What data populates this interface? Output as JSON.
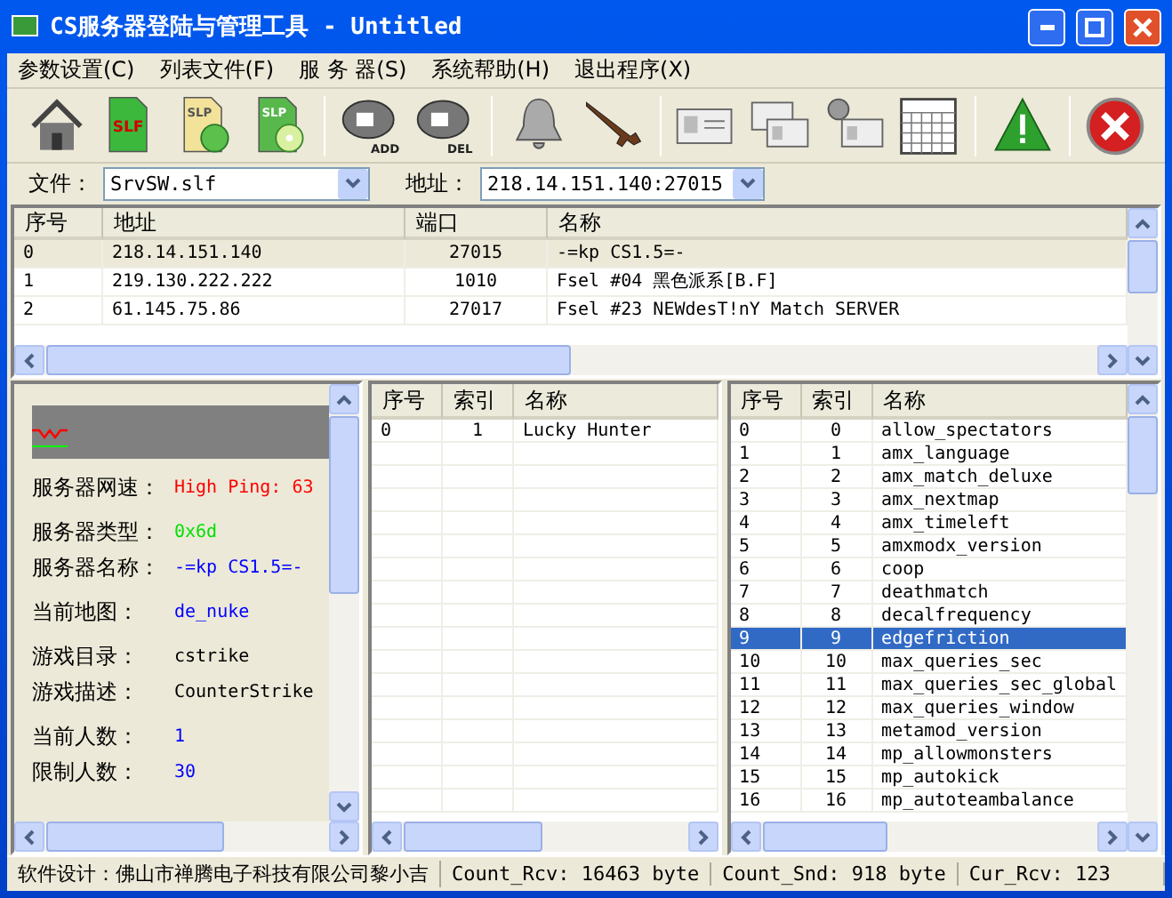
{
  "window": {
    "title": "CS服务器登陆与管理工具 - Untitled"
  },
  "menu": [
    {
      "label": "参数设置(C)"
    },
    {
      "label": "列表文件(F)"
    },
    {
      "label": "服 务 器(S)"
    },
    {
      "label": "系统帮助(H)"
    },
    {
      "label": "退出程序(X)"
    }
  ],
  "toolbar_labels": [
    "SLF",
    "SLP",
    "SLP",
    "ADD",
    "DEL"
  ],
  "address_bar": {
    "file_label": "文件：",
    "file_value": "SrvSW.slf",
    "address_label": "地址：",
    "address_value": "218.14.151.140:27015"
  },
  "servers": {
    "columns": [
      "序号",
      "地址",
      "端口",
      "名称"
    ],
    "rows": [
      {
        "cells": [
          "0",
          "218.14.151.140",
          "27015",
          "-=kp  CS1.5=-"
        ],
        "selected": true
      },
      {
        "cells": [
          "1",
          "219.130.222.222",
          "1010",
          "Fsel #04 黑色派系[B.F]"
        ],
        "selected": false
      },
      {
        "cells": [
          "2",
          "61.145.75.86",
          "27017",
          "Fsel #23 NEWdesT!nY Match SERVER"
        ],
        "selected": false
      }
    ]
  },
  "server_info": {
    "groups": [
      {
        "rows": [
          {
            "label": "服务器网速：",
            "value": "High Ping: 63",
            "color": "#ff0000"
          }
        ]
      },
      {
        "rows": [
          {
            "label": "服务器类型：",
            "value": "0x6d",
            "color": "#00e000"
          },
          {
            "label": "服务器名称：",
            "value": "-=kp  CS1.5=-",
            "color": "#0000ff"
          }
        ]
      },
      {
        "rows": [
          {
            "label": "当前地图：",
            "value": "de_nuke",
            "color": "#0000ff"
          }
        ]
      },
      {
        "rows": [
          {
            "label": "游戏目录：",
            "value": "cstrike",
            "color": "#000000"
          },
          {
            "label": "游戏描述：",
            "value": "CounterStrike",
            "color": "#000000"
          }
        ]
      },
      {
        "rows": [
          {
            "label": "当前人数：",
            "value": "1",
            "color": "#0000ff"
          },
          {
            "label": "限制人数：",
            "value": "30",
            "color": "#0000ff"
          }
        ]
      }
    ]
  },
  "players": {
    "columns": [
      "序号",
      "索引",
      "名称"
    ],
    "rows": [
      {
        "cells": [
          "0",
          "1",
          "Lucky Hunter"
        ],
        "selected": false
      }
    ]
  },
  "cvars": {
    "columns": [
      "序号",
      "索引",
      "名称"
    ],
    "rows": [
      {
        "cells": [
          "0",
          "0",
          "allow_spectators"
        ],
        "selected": false
      },
      {
        "cells": [
          "1",
          "1",
          "amx_language"
        ],
        "selected": false
      },
      {
        "cells": [
          "2",
          "2",
          "amx_match_deluxe"
        ],
        "selected": false
      },
      {
        "cells": [
          "3",
          "3",
          "amx_nextmap"
        ],
        "selected": false
      },
      {
        "cells": [
          "4",
          "4",
          "amx_timeleft"
        ],
        "selected": false
      },
      {
        "cells": [
          "5",
          "5",
          "amxmodx_version"
        ],
        "selected": false
      },
      {
        "cells": [
          "6",
          "6",
          "coop"
        ],
        "selected": false
      },
      {
        "cells": [
          "7",
          "7",
          "deathmatch"
        ],
        "selected": false
      },
      {
        "cells": [
          "8",
          "8",
          "decalfrequency"
        ],
        "selected": false
      },
      {
        "cells": [
          "9",
          "9",
          "edgefriction"
        ],
        "selected": true
      },
      {
        "cells": [
          "10",
          "10",
          "max_queries_sec"
        ],
        "selected": false
      },
      {
        "cells": [
          "11",
          "11",
          "max_queries_sec_global"
        ],
        "selected": false
      },
      {
        "cells": [
          "12",
          "12",
          "max_queries_window"
        ],
        "selected": false
      },
      {
        "cells": [
          "13",
          "13",
          "metamod_version"
        ],
        "selected": false
      },
      {
        "cells": [
          "14",
          "14",
          "mp_allowmonsters"
        ],
        "selected": false
      },
      {
        "cells": [
          "15",
          "15",
          "mp_autokick"
        ],
        "selected": false
      },
      {
        "cells": [
          "16",
          "16",
          "mp_autoteambalance"
        ],
        "selected": false
      }
    ]
  },
  "status_bar": [
    "软件设计：佛山市禅腾电子科技有限公司黎小吉",
    "Count_Rcv: 16463 byte",
    "Count_Snd: 918 byte",
    "Cur_Rcv: 123"
  ]
}
